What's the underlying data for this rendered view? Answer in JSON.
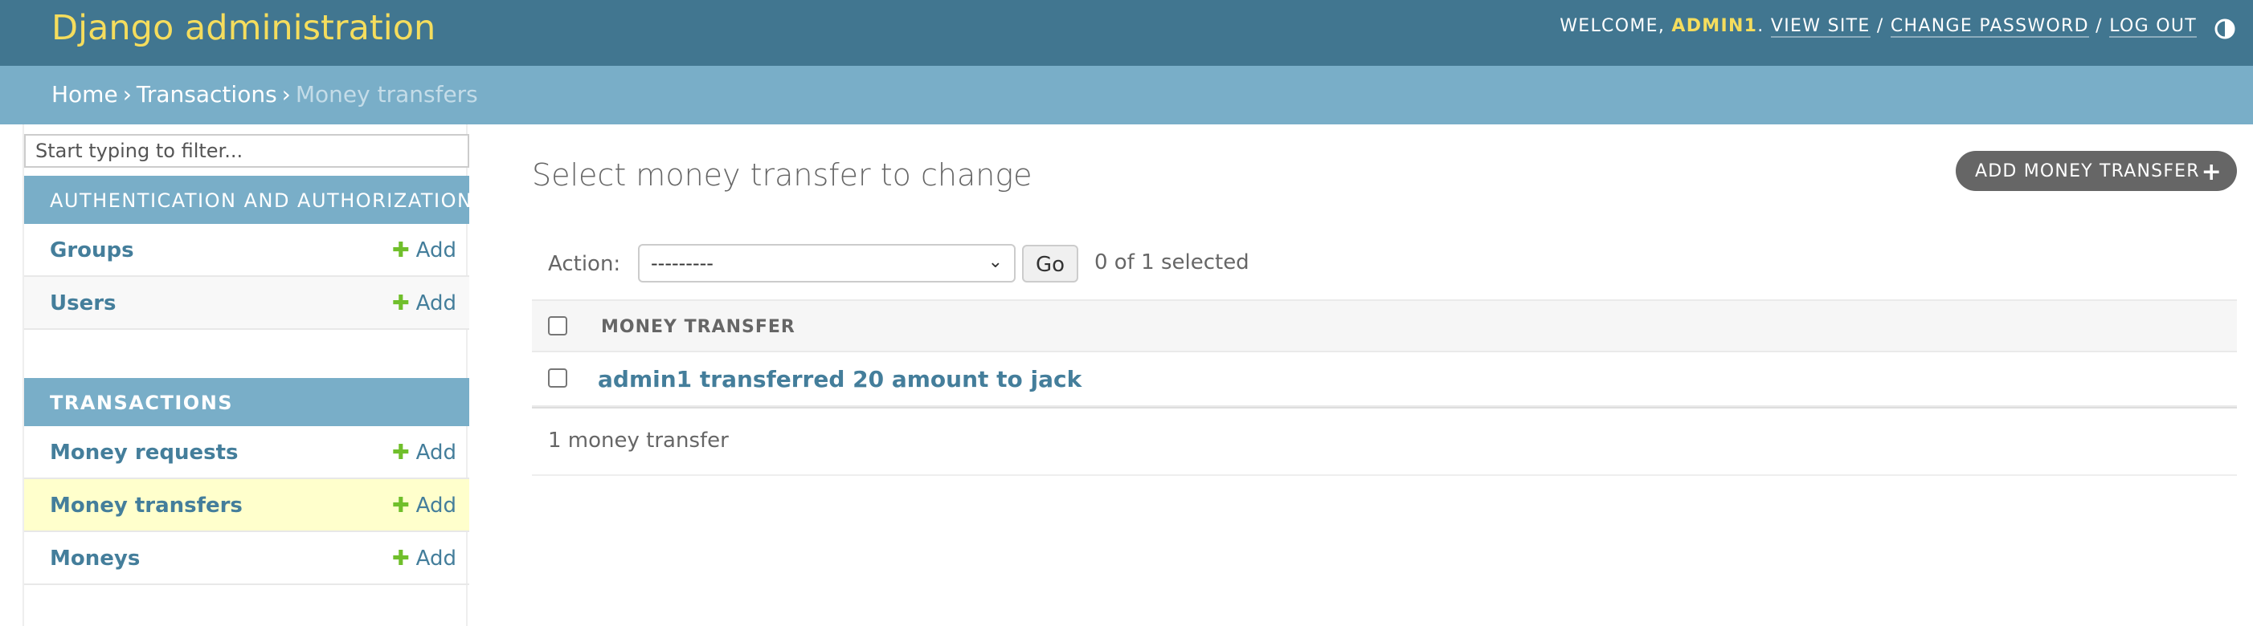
{
  "header": {
    "site_title": "Django administration",
    "welcome": "WELCOME, ",
    "username": "ADMIN1",
    "view_site": "VIEW SITE",
    "change_password": "CHANGE PASSWORD",
    "log_out": "LOG OUT",
    "separator": " / ",
    "theme_icon": "half-circle-icon"
  },
  "breadcrumbs": {
    "home": "Home",
    "app": "Transactions",
    "current": "Money transfers",
    "separator": "›"
  },
  "sidebar": {
    "filter_placeholder": "Start typing to filter...",
    "modules": [
      {
        "caption": "AUTHENTICATION AND AUTHORIZATION",
        "models": [
          {
            "name": "Groups",
            "add": "Add"
          },
          {
            "name": "Users",
            "add": "Add"
          }
        ]
      },
      {
        "caption": "TRANSACTIONS",
        "models": [
          {
            "name": "Money requests",
            "add": "Add"
          },
          {
            "name": "Money transfers",
            "add": "Add"
          },
          {
            "name": "Moneys",
            "add": "Add"
          }
        ]
      }
    ]
  },
  "main": {
    "title": "Select money transfer to change",
    "add_button": "ADD MONEY TRANSFER",
    "add_icon": "+",
    "action_label": "Action:",
    "action_selected": "---------",
    "go_button": "Go",
    "selected_count": "0 of 1 selected",
    "column_header": "MONEY TRANSFER",
    "rows": [
      {
        "label": "admin1 transferred 20 amount to jack"
      }
    ],
    "paginator": "1 money transfer"
  },
  "colors": {
    "header_bg": "#417690",
    "breadcrumb_bg": "#79aec8",
    "title_yellow": "#f5dd5d",
    "link_blue": "#447e9b",
    "add_green": "#70bf2b",
    "selected_row": "#ffffcc"
  }
}
